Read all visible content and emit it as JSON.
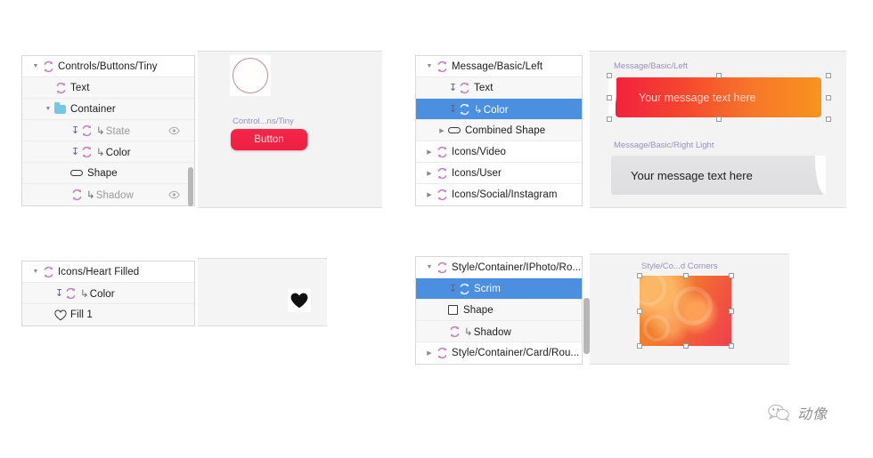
{
  "app": {
    "watermark_text": "动像"
  },
  "colors": {
    "selection_blue": "#4a8fe0",
    "symbol_pink": "#c47fc0",
    "button_red": "#f2213f",
    "bubble_gradient_start": "#f2213f",
    "bubble_gradient_end": "#f7941d",
    "folder_blue": "#73c8e8",
    "artboard_label": "#9b8fc4"
  },
  "panels": [
    {
      "id": "controls-buttons-tiny",
      "layers": [
        {
          "label": "Controls/Buttons/Tiny",
          "icon": "symbol-icon",
          "disclosure": "open",
          "depth": 0,
          "selected": false,
          "dim": false,
          "override": false,
          "eye": false,
          "arrow_prefix": ""
        },
        {
          "label": "Text",
          "icon": "symbol-icon",
          "disclosure": "none",
          "depth": 1,
          "selected": false,
          "dim": false,
          "override": false,
          "eye": false,
          "arrow_prefix": ""
        },
        {
          "label": "Container",
          "icon": "folder-icon",
          "disclosure": "open",
          "depth": 1,
          "selected": false,
          "dim": false,
          "override": false,
          "eye": false,
          "arrow_prefix": ""
        },
        {
          "label": "State",
          "icon": "symbol-icon",
          "disclosure": "none",
          "depth": 2,
          "selected": false,
          "dim": true,
          "override": true,
          "eye": true,
          "arrow_prefix": "↳"
        },
        {
          "label": "Color",
          "icon": "symbol-icon",
          "disclosure": "none",
          "depth": 2,
          "selected": false,
          "dim": false,
          "override": true,
          "eye": false,
          "arrow_prefix": "↳"
        },
        {
          "label": "Shape",
          "icon": "pill-icon",
          "disclosure": "none",
          "depth": 2,
          "selected": false,
          "dim": false,
          "override": false,
          "eye": false,
          "arrow_prefix": ""
        },
        {
          "label": "Shadow",
          "icon": "symbol-icon",
          "disclosure": "none",
          "depth": 2,
          "selected": false,
          "dim": true,
          "override": false,
          "eye": true,
          "arrow_prefix": "↳"
        }
      ],
      "artboard_label": "Control...ns/Tiny",
      "button_label": "Button"
    },
    {
      "id": "message-basic-left",
      "layers": [
        {
          "label": "Message/Basic/Left",
          "icon": "symbol-icon",
          "disclosure": "open",
          "depth": 0,
          "selected": false,
          "dim": false,
          "override": false,
          "eye": false,
          "arrow_prefix": ""
        },
        {
          "label": "Text",
          "icon": "symbol-icon",
          "disclosure": "none",
          "depth": 1,
          "selected": false,
          "dim": false,
          "override": true,
          "eye": false,
          "arrow_prefix": ""
        },
        {
          "label": "Color",
          "icon": "symbol-icon",
          "disclosure": "none",
          "depth": 1,
          "selected": true,
          "dim": false,
          "override": true,
          "eye": false,
          "arrow_prefix": "↳"
        },
        {
          "label": "Combined Shape",
          "icon": "pill-icon",
          "disclosure": "closed",
          "depth": 1,
          "selected": false,
          "dim": false,
          "override": false,
          "eye": false,
          "arrow_prefix": ""
        },
        {
          "label": "Icons/Video",
          "icon": "symbol-icon",
          "disclosure": "closed",
          "depth": 0,
          "selected": false,
          "dim": false,
          "override": false,
          "eye": false,
          "arrow_prefix": ""
        },
        {
          "label": "Icons/User",
          "icon": "symbol-icon",
          "disclosure": "closed",
          "depth": 0,
          "selected": false,
          "dim": false,
          "override": false,
          "eye": false,
          "arrow_prefix": ""
        },
        {
          "label": "Icons/Social/Instagram",
          "icon": "symbol-icon",
          "disclosure": "closed",
          "depth": 0,
          "selected": false,
          "dim": false,
          "override": false,
          "eye": false,
          "arrow_prefix": ""
        }
      ],
      "artboard_label_1": "Message/Basic/Left",
      "bubble_text_1": "Your message text here",
      "artboard_label_2": "Message/Basic/Right Light",
      "bubble_text_2": "Your message text here"
    },
    {
      "id": "icons-heart-filled",
      "layers": [
        {
          "label": "Icons/Heart Filled",
          "icon": "symbol-icon",
          "disclosure": "open",
          "depth": 0,
          "selected": false,
          "dim": false,
          "override": false,
          "eye": false,
          "arrow_prefix": ""
        },
        {
          "label": "Color",
          "icon": "symbol-icon",
          "disclosure": "none",
          "depth": 1,
          "selected": false,
          "dim": false,
          "override": true,
          "eye": false,
          "arrow_prefix": "↳"
        },
        {
          "label": "Fill 1",
          "icon": "heart-icon",
          "disclosure": "none",
          "depth": 1,
          "selected": false,
          "dim": false,
          "override": false,
          "eye": false,
          "arrow_prefix": ""
        }
      ]
    },
    {
      "id": "style-container-iphoto",
      "layers": [
        {
          "label": "Style/Container/IPhoto/Ro...",
          "icon": "symbol-icon",
          "disclosure": "open",
          "depth": 0,
          "selected": false,
          "dim": false,
          "override": false,
          "eye": false,
          "arrow_prefix": ""
        },
        {
          "label": "Scrim",
          "icon": "symbol-icon",
          "disclosure": "none",
          "depth": 1,
          "selected": true,
          "dim": false,
          "override": true,
          "eye": false,
          "arrow_prefix": ""
        },
        {
          "label": "Shape",
          "icon": "square-icon",
          "disclosure": "none",
          "depth": 1,
          "selected": false,
          "dim": false,
          "override": false,
          "eye": false,
          "arrow_prefix": ""
        },
        {
          "label": "Shadow",
          "icon": "symbol-icon",
          "disclosure": "none",
          "depth": 1,
          "selected": false,
          "dim": false,
          "override": false,
          "eye": false,
          "arrow_prefix": "↳"
        },
        {
          "label": "Style/Container/Card/Rou...",
          "icon": "symbol-icon",
          "disclosure": "closed",
          "depth": 0,
          "selected": false,
          "dim": false,
          "override": false,
          "eye": false,
          "arrow_prefix": ""
        }
      ],
      "artboard_label": "Style/Co...d Corners"
    }
  ]
}
